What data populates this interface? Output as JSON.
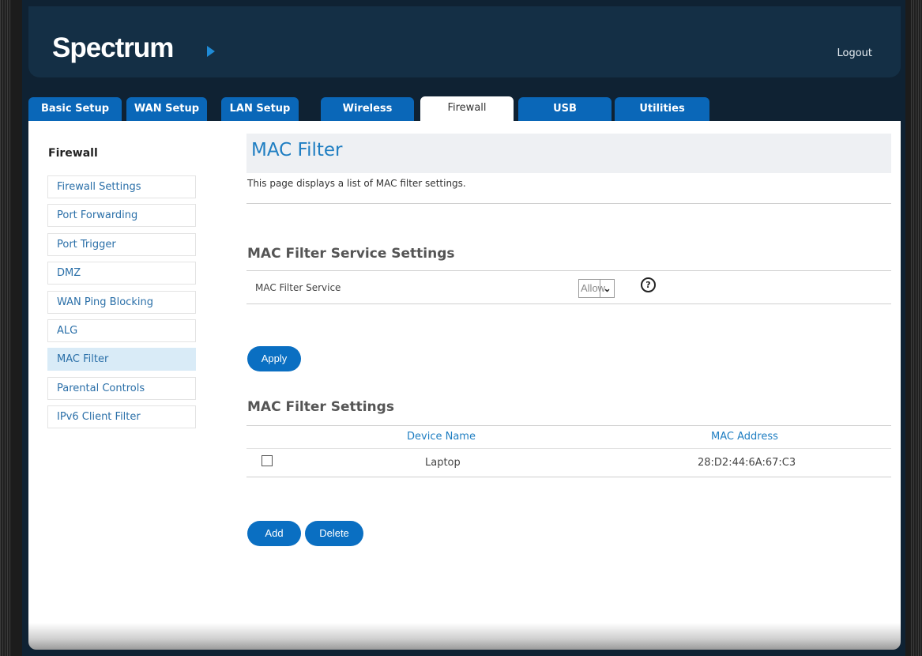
{
  "header": {
    "logo_text": "Spectrum",
    "logout_label": "Logout"
  },
  "tabs": [
    {
      "label": "Basic Setup"
    },
    {
      "label": "WAN Setup"
    },
    {
      "label": "LAN Setup"
    },
    {
      "label": "Wireless"
    },
    {
      "label": "Firewall",
      "active": true
    },
    {
      "label": "USB"
    },
    {
      "label": "Utilities"
    }
  ],
  "sidebar": {
    "title": "Firewall",
    "items": [
      {
        "label": "Firewall Settings"
      },
      {
        "label": "Port Forwarding"
      },
      {
        "label": "Port Trigger"
      },
      {
        "label": "DMZ"
      },
      {
        "label": "WAN Ping Blocking"
      },
      {
        "label": "ALG"
      },
      {
        "label": "MAC Filter",
        "active": true
      },
      {
        "label": "Parental Controls"
      },
      {
        "label": "IPv6 Client Filter"
      }
    ]
  },
  "main": {
    "title": "MAC Filter",
    "description": "This page displays a list of MAC filter settings.",
    "service_section_title": "MAC Filter Service Settings",
    "service_label": "MAC Filter Service",
    "service_value": "Allow",
    "help_glyph": "?",
    "apply_label": "Apply",
    "settings_section_title": "MAC Filter Settings",
    "table": {
      "headers": [
        "Device Name",
        "MAC Address"
      ],
      "rows": [
        {
          "checked": false,
          "device_name": "Laptop",
          "mac_address": "28:D2:44:6A:67:C3"
        }
      ]
    },
    "add_label": "Add",
    "delete_label": "Delete"
  },
  "colors": {
    "accent": "#0a6fc2",
    "header_bg": "#142f45",
    "link": "#2a6fa8"
  }
}
